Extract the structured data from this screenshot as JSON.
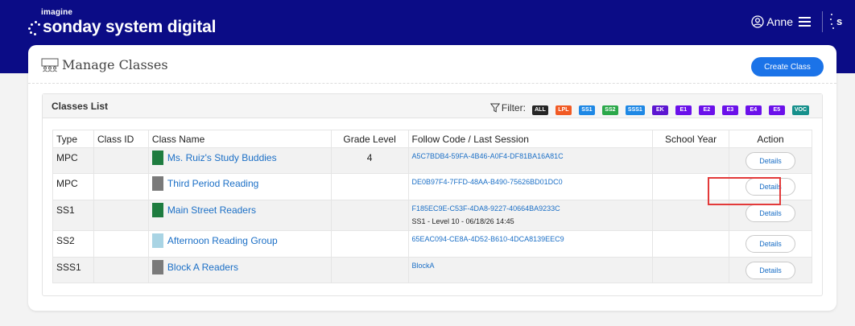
{
  "brand": {
    "small": "imagine",
    "main": "sonday system digital"
  },
  "user": {
    "name": "Anne",
    "icons": [
      "user-circle-icon",
      "hamburger-menu-icon",
      "sonday-s-icon"
    ]
  },
  "page": {
    "title": "Manage Classes",
    "title_icon": "classroom-icon",
    "create_button": "Create Class"
  },
  "classes_panel": {
    "title": "Classes List",
    "filter_label": "Filter:",
    "filter_icon": "funnel-icon",
    "filters": [
      {
        "label": "ALL",
        "color": "#262626"
      },
      {
        "label": "LPL",
        "color": "#f15a24"
      },
      {
        "label": "SS1",
        "color": "#1e88e5"
      },
      {
        "label": "SS2",
        "color": "#2ba84a"
      },
      {
        "label": "SSS1",
        "color": "#1e88e5"
      },
      {
        "label": "EK",
        "color": "#5c16d1"
      },
      {
        "label": "E1",
        "color": "#6b11ea"
      },
      {
        "label": "E2",
        "color": "#6b11ea"
      },
      {
        "label": "E3",
        "color": "#6b11ea"
      },
      {
        "label": "E4",
        "color": "#6b11ea"
      },
      {
        "label": "E5",
        "color": "#6b11ea"
      },
      {
        "label": "VOC",
        "color": "#17908c"
      }
    ]
  },
  "table": {
    "headers": {
      "type": "Type",
      "class_id": "Class ID",
      "class_name": "Class Name",
      "grade_level": "Grade Level",
      "follow_code": "Follow Code / Last Session",
      "school_year": "School Year",
      "action": "Action"
    },
    "rows": [
      {
        "type": "MPC",
        "class_id": "",
        "name": "Ms. Ruiz's Study Buddies",
        "color": "#1e7c3f",
        "grade": "4",
        "follow_code": "A5C7BDB4-59FA-4B46-A0F4-DF81BA16A81C",
        "last_session": "",
        "school_year": "",
        "action": "Details"
      },
      {
        "type": "MPC",
        "class_id": "",
        "name": "Third Period Reading",
        "color": "#7a7a7a",
        "grade": "",
        "follow_code": "DE0B97F4-7FFD-48AA-B490-75626BD01DC0",
        "last_session": "",
        "school_year": "",
        "action": "Details"
      },
      {
        "type": "SS1",
        "class_id": "",
        "name": "Main Street Readers",
        "color": "#1e7c3f",
        "grade": "",
        "follow_code": "F185EC9E-C53F-4DA8-9227-40664BA9233C",
        "last_session": "SS1 - Level 10 - 06/18/26 14:45",
        "school_year": "",
        "action": "Details"
      },
      {
        "type": "SS2",
        "class_id": "",
        "name": "Afternoon Reading Group",
        "color": "#a9d4e4",
        "grade": "",
        "follow_code": "65EAC094-CE8A-4D52-B610-4DCA8139EEC9",
        "last_session": "",
        "school_year": "",
        "action": "Details"
      },
      {
        "type": "SSS1",
        "class_id": "",
        "name": "Block A Readers",
        "color": "#7a7a7a",
        "grade": "",
        "follow_code": "BlockA",
        "last_session": "",
        "school_year": "",
        "action": "Details"
      }
    ]
  }
}
